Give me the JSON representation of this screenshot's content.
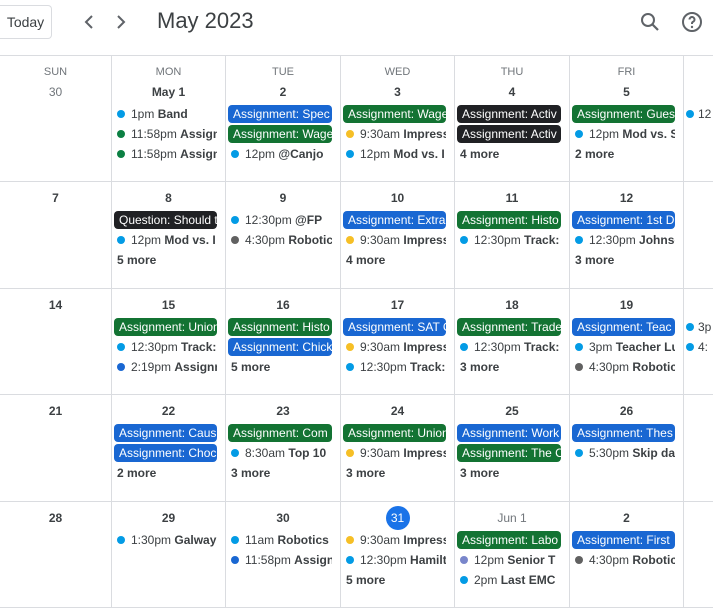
{
  "header": {
    "today_label": "Today",
    "month_title": "May 2023",
    "prev_icon": "chevron-left-icon",
    "next_icon": "chevron-right-icon",
    "search_icon": "search-icon",
    "help_icon": "help-icon"
  },
  "weekdays": [
    "SUN",
    "MON",
    "TUE",
    "WED",
    "THU",
    "FRI",
    ""
  ],
  "colors": {
    "blue_chip": "#1967d2",
    "green_chip": "#137333",
    "black_chip": "#202124",
    "today": "#1a73e8",
    "dot_lightblue": "#039be5",
    "dot_green": "#0b8043",
    "dot_yellow": "#f6bf26",
    "dot_darkblue": "#1967d2",
    "dot_gray": "#616161",
    "dot_lavender": "#7986cb"
  },
  "weeks": [
    {
      "days": [
        {
          "date": "30",
          "other": true,
          "events": []
        },
        {
          "date": "May 1",
          "events": [
            {
              "kind": "dot",
              "color": "#039be5",
              "time": "1pm",
              "title": "Band"
            },
            {
              "kind": "dot",
              "color": "#0b8043",
              "time": "11:58pm",
              "title": "Assignment"
            },
            {
              "kind": "dot",
              "color": "#0b8043",
              "time": "11:58pm",
              "title": "Assignment"
            }
          ]
        },
        {
          "date": "2",
          "events": [
            {
              "kind": "chip",
              "color": "#1967d2",
              "title": "Assignment: Spec"
            },
            {
              "kind": "chip",
              "color": "#137333",
              "title": "Assignment: Wage"
            },
            {
              "kind": "dot",
              "color": "#039be5",
              "time": "12pm",
              "title": "@Canjo"
            }
          ]
        },
        {
          "date": "3",
          "events": [
            {
              "kind": "chip",
              "color": "#137333",
              "title": "Assignment: Wage"
            },
            {
              "kind": "dot",
              "color": "#f6bf26",
              "time": "9:30am",
              "title": "Impressions"
            },
            {
              "kind": "dot",
              "color": "#039be5",
              "time": "12pm",
              "title": "Mod vs. I"
            }
          ]
        },
        {
          "date": "4",
          "events": [
            {
              "kind": "chip",
              "color": "#202124",
              "title": "Assignment: Activ"
            },
            {
              "kind": "chip",
              "color": "#202124",
              "title": "Assignment: Activ"
            }
          ],
          "more": "4 more"
        },
        {
          "date": "5",
          "events": [
            {
              "kind": "chip",
              "color": "#137333",
              "title": "Assignment: Gues"
            },
            {
              "kind": "dot",
              "color": "#039be5",
              "time": "12pm",
              "title": "Mod vs. S"
            }
          ],
          "more": "2 more"
        },
        {
          "date": "",
          "events": [
            {
              "kind": "dot",
              "color": "#039be5",
              "time": "12",
              "title": ""
            }
          ]
        }
      ]
    },
    {
      "days": [
        {
          "date": "7",
          "events": []
        },
        {
          "date": "8",
          "events": [
            {
              "kind": "chip",
              "color": "#202124",
              "title": "Question: Should t"
            },
            {
              "kind": "dot",
              "color": "#039be5",
              "time": "12pm",
              "title": "Mod vs. I"
            }
          ],
          "more": "5 more"
        },
        {
          "date": "9",
          "events": [
            {
              "kind": "dot",
              "color": "#039be5",
              "time": "12:30pm",
              "title": "@FP"
            },
            {
              "kind": "dot",
              "color": "#616161",
              "time": "4:30pm",
              "title": "Robotics"
            }
          ]
        },
        {
          "date": "10",
          "events": [
            {
              "kind": "chip",
              "color": "#1967d2",
              "title": "Assignment: Extra"
            },
            {
              "kind": "dot",
              "color": "#f6bf26",
              "time": "9:30am",
              "title": "Impressions"
            }
          ],
          "more": "4 more"
        },
        {
          "date": "11",
          "events": [
            {
              "kind": "chip",
              "color": "#137333",
              "title": "Assignment: Histo"
            },
            {
              "kind": "dot",
              "color": "#039be5",
              "time": "12:30pm",
              "title": "Track:"
            }
          ]
        },
        {
          "date": "12",
          "events": [
            {
              "kind": "chip",
              "color": "#1967d2",
              "title": "Assignment: 1st D"
            },
            {
              "kind": "dot",
              "color": "#039be5",
              "time": "12:30pm",
              "title": "Johnson"
            }
          ],
          "more": "3 more"
        },
        {
          "date": "",
          "events": []
        }
      ]
    },
    {
      "days": [
        {
          "date": "14",
          "events": []
        },
        {
          "date": "15",
          "events": [
            {
              "kind": "chip",
              "color": "#137333",
              "title": "Assignment: Union"
            },
            {
              "kind": "dot",
              "color": "#039be5",
              "time": "12:30pm",
              "title": "Track:"
            },
            {
              "kind": "dot",
              "color": "#1967d2",
              "time": "2:19pm",
              "title": "Assignment"
            }
          ]
        },
        {
          "date": "16",
          "events": [
            {
              "kind": "chip",
              "color": "#137333",
              "title": "Assignment: Histo"
            },
            {
              "kind": "chip",
              "color": "#1967d2",
              "title": "Assignment: Chick"
            }
          ],
          "more": "5 more"
        },
        {
          "date": "17",
          "events": [
            {
              "kind": "chip",
              "color": "#1967d2",
              "title": "Assignment: SAT C"
            },
            {
              "kind": "dot",
              "color": "#f6bf26",
              "time": "9:30am",
              "title": "Impressions"
            },
            {
              "kind": "dot",
              "color": "#039be5",
              "time": "12:30pm",
              "title": "Track:"
            }
          ]
        },
        {
          "date": "18",
          "events": [
            {
              "kind": "chip",
              "color": "#137333",
              "title": "Assignment: Trade"
            },
            {
              "kind": "dot",
              "color": "#039be5",
              "time": "12:30pm",
              "title": "Track:"
            }
          ],
          "more": "3 more"
        },
        {
          "date": "19",
          "events": [
            {
              "kind": "chip",
              "color": "#1967d2",
              "title": "Assignment: Teac"
            },
            {
              "kind": "dot",
              "color": "#039be5",
              "time": "3pm",
              "title": "Teacher Lu"
            },
            {
              "kind": "dot",
              "color": "#616161",
              "time": "4:30pm",
              "title": "Robotics"
            }
          ]
        },
        {
          "date": "",
          "events": [
            {
              "kind": "dot",
              "color": "#039be5",
              "time": "3p",
              "title": ""
            },
            {
              "kind": "dot",
              "color": "#039be5",
              "time": "4:",
              "title": ""
            }
          ]
        }
      ]
    },
    {
      "days": [
        {
          "date": "21",
          "events": []
        },
        {
          "date": "22",
          "events": [
            {
              "kind": "chip",
              "color": "#1967d2",
              "title": "Assignment: Caus"
            },
            {
              "kind": "chip",
              "color": "#1967d2",
              "title": "Assignment: Choc"
            }
          ],
          "more": "2 more"
        },
        {
          "date": "23",
          "events": [
            {
              "kind": "chip",
              "color": "#137333",
              "title": "Assignment: Com"
            },
            {
              "kind": "dot",
              "color": "#039be5",
              "time": "8:30am",
              "title": "Top 10"
            }
          ],
          "more": "3 more"
        },
        {
          "date": "24",
          "events": [
            {
              "kind": "chip",
              "color": "#137333",
              "title": "Assignment: Union"
            },
            {
              "kind": "dot",
              "color": "#f6bf26",
              "time": "9:30am",
              "title": "Impressions"
            }
          ],
          "more": "3 more"
        },
        {
          "date": "25",
          "events": [
            {
              "kind": "chip",
              "color": "#1967d2",
              "title": "Assignment: Work"
            },
            {
              "kind": "chip",
              "color": "#137333",
              "title": "Assignment: The C"
            }
          ],
          "more": "3 more"
        },
        {
          "date": "26",
          "events": [
            {
              "kind": "chip",
              "color": "#1967d2",
              "title": "Assignment: Thes"
            },
            {
              "kind": "dot",
              "color": "#039be5",
              "time": "5:30pm",
              "title": "Skip day"
            }
          ]
        },
        {
          "date": "",
          "events": []
        }
      ]
    },
    {
      "days": [
        {
          "date": "28",
          "events": []
        },
        {
          "date": "29",
          "events": [
            {
              "kind": "dot",
              "color": "#039be5",
              "time": "1:30pm",
              "title": "Galway"
            }
          ]
        },
        {
          "date": "30",
          "events": [
            {
              "kind": "dot",
              "color": "#039be5",
              "time": "11am",
              "title": "Robotics"
            },
            {
              "kind": "dot",
              "color": "#1967d2",
              "time": "11:58pm",
              "title": "Assignment"
            }
          ]
        },
        {
          "date": "31",
          "today": true,
          "events": [
            {
              "kind": "dot",
              "color": "#f6bf26",
              "time": "9:30am",
              "title": "Impressions"
            },
            {
              "kind": "dot",
              "color": "#039be5",
              "time": "12:30pm",
              "title": "Hamilton"
            }
          ],
          "more": "5 more"
        },
        {
          "date": "Jun 1",
          "other": true,
          "events": [
            {
              "kind": "chip",
              "color": "#137333",
              "title": "Assignment: Labo"
            },
            {
              "kind": "dot",
              "color": "#7986cb",
              "time": "12pm",
              "title": "Senior T"
            },
            {
              "kind": "dot",
              "color": "#039be5",
              "time": "2pm",
              "title": "Last EMC"
            }
          ]
        },
        {
          "date": "2",
          "events": [
            {
              "kind": "chip",
              "color": "#1967d2",
              "title": "Assignment: First"
            },
            {
              "kind": "dot",
              "color": "#616161",
              "time": "4:30pm",
              "title": "Robotics"
            }
          ]
        },
        {
          "date": "",
          "events": []
        }
      ]
    }
  ]
}
